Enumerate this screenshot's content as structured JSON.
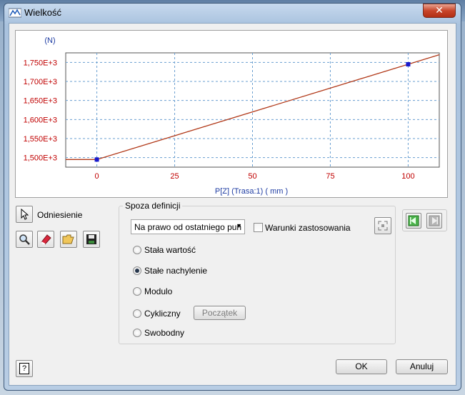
{
  "window": {
    "title": "Wielkość",
    "close_glyph": "✕"
  },
  "chart_data": {
    "type": "line",
    "title": "",
    "ylabel": "(N)",
    "xlabel": "P[Z] (Trasa:1) ( mm )",
    "x_ticks": [
      "0",
      "25",
      "50",
      "75",
      "100"
    ],
    "y_ticks": [
      "1,500E+3",
      "1,550E+3",
      "1,600E+3",
      "1,650E+3",
      "1,700E+3",
      "1,750E+3"
    ],
    "xlim": [
      -10,
      110
    ],
    "ylim": [
      1475,
      1775
    ],
    "grid": true,
    "series": [
      {
        "points": [
          [
            -10,
            1495
          ],
          [
            0,
            1495
          ],
          [
            100,
            1745
          ],
          [
            110,
            1770
          ]
        ],
        "color": "#b23a1a"
      }
    ],
    "markers": [
      [
        0,
        1495
      ],
      [
        100,
        1745
      ]
    ],
    "colors": {
      "axis_text": "#c00000",
      "label_text": "#1f3da3",
      "grid": "#6a9fd0",
      "marker": "#1a1acc"
    }
  },
  "toolbar": {
    "reference_label": "Odniesienie",
    "icons": [
      "cursor-icon",
      "zoom-icon",
      "eraser-icon",
      "open-folder-icon",
      "save-icon"
    ]
  },
  "outside": {
    "group_label": "Spoza definicji",
    "dropdown_value": "Na prawo od ostatniego pun",
    "conditions_label": "Warunki zastosowania",
    "options": [
      {
        "label": "Stała wartość",
        "selected": false
      },
      {
        "label": "Stałe nachylenie",
        "selected": true
      },
      {
        "label": "Modulo",
        "selected": false
      },
      {
        "label": "Cykliczny",
        "selected": false
      },
      {
        "label": "Swobodny",
        "selected": false
      }
    ],
    "start_button": "Początek"
  },
  "buttons": {
    "ok": "OK",
    "cancel": "Anuluj",
    "help": "?"
  }
}
